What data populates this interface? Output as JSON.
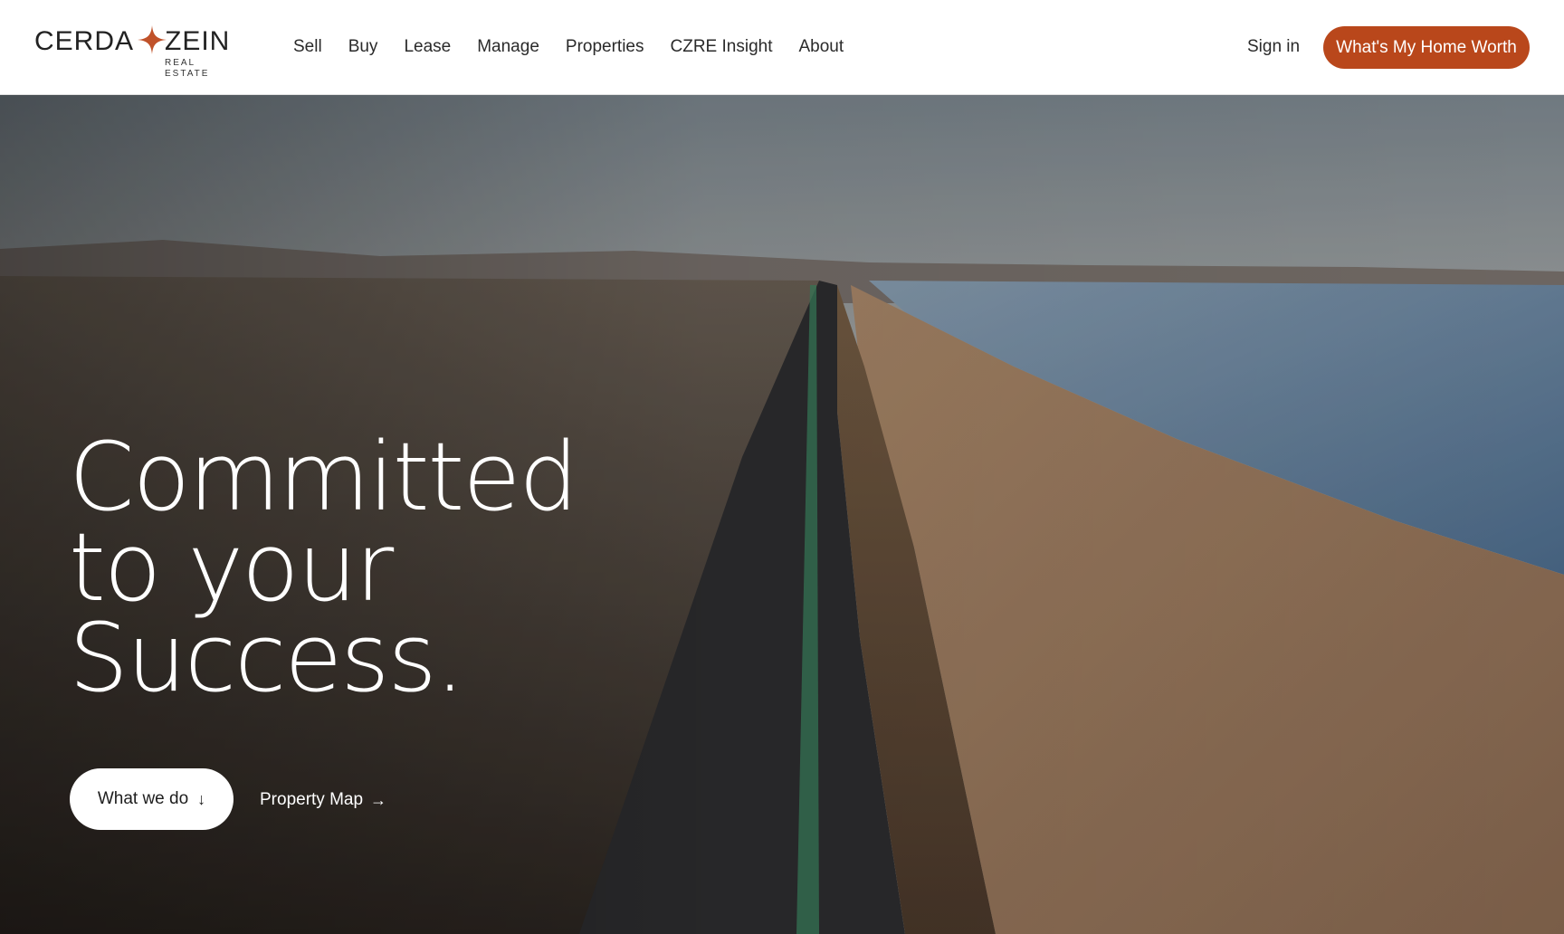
{
  "logo": {
    "left_word": "CERDA",
    "right_word": "ZEIN",
    "subtitle": "REAL ESTATE",
    "accent_color": "#c0522a"
  },
  "nav": {
    "items": [
      {
        "label": "Sell"
      },
      {
        "label": "Buy"
      },
      {
        "label": "Lease"
      },
      {
        "label": "Manage"
      },
      {
        "label": "Properties"
      },
      {
        "label": "CZRE Insight"
      },
      {
        "label": "About"
      }
    ]
  },
  "header": {
    "signin_label": "Sign in",
    "cta_label": "What's My Home Worth",
    "cta_color": "#b9471b"
  },
  "hero": {
    "title_lines": [
      "Committed",
      "to your",
      "Success."
    ],
    "primary_button": {
      "label": "What we do",
      "icon": "arrow-down-icon"
    },
    "secondary_link": {
      "label": "Property Map",
      "icon": "arrow-right-icon"
    }
  }
}
